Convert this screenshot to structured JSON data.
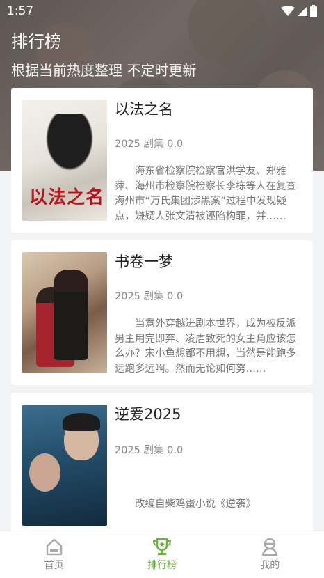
{
  "status": {
    "time": "1:57"
  },
  "header": {
    "title": "排行榜",
    "subtitle": "根据当前热度整理 不定时更新"
  },
  "items": [
    {
      "title": "以法之名",
      "meta": "2025 剧集 0.0",
      "description": "海东省检察院检察官洪学友、郑雅萍、海州市检察院检察长李栋等人在复查海州市“万氏集团涉黑案”过程中发现疑点，嫌疑人张文清被诬陷构罪，并……",
      "poster_icon": "movie-poster"
    },
    {
      "title": "书卷一梦",
      "meta": "2025 剧集 0.0",
      "description": "当意外穿越进剧本世界，成为被反派男主用完即弃、凌虐致死的女主角应该怎么办？宋小鱼想都不用想，当然是能跑多远跑多远啊。然而无论如何努……",
      "poster_icon": "movie-poster"
    },
    {
      "title": "逆爱2025",
      "meta": "2025 剧集 0.0",
      "description": "改编自柴鸡蛋小说《逆袭》",
      "poster_icon": "movie-poster"
    }
  ],
  "tabbar": {
    "tabs": [
      {
        "label": "首页",
        "icon": "home-icon",
        "active": false
      },
      {
        "label": "排行榜",
        "icon": "trophy-icon",
        "active": true
      },
      {
        "label": "我的",
        "icon": "user-icon",
        "active": false
      }
    ]
  },
  "colors": {
    "accent": "#6bb33c",
    "inactive": "#888888",
    "background": "#f2f3f5"
  }
}
